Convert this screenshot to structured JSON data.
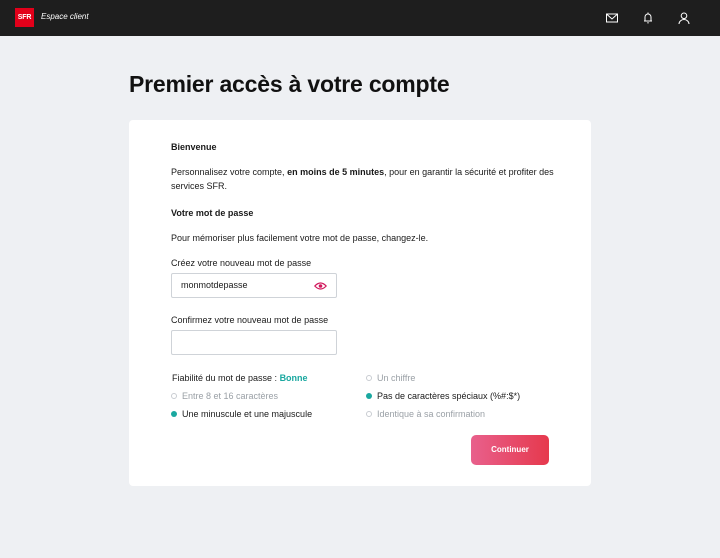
{
  "header": {
    "logo_text": "SFR",
    "brand_subtitle": "Espace client",
    "icons": [
      "mail-icon",
      "bell-icon",
      "user-icon"
    ]
  },
  "page": {
    "title": "Premier accès à votre compte"
  },
  "card": {
    "welcome_heading": "Bienvenue",
    "intro_before": "Personnalisez votre compte, ",
    "intro_bold": "en moins de 5 minutes",
    "intro_after": ", pour en garantir la sécurité et profiter des services SFR.",
    "password_heading": "Votre mot de passe",
    "password_hint": "Pour mémoriser plus facilement votre mot de passe, changez-le.",
    "new_password_label": "Créez votre nouveau mot de passe",
    "new_password_value": "monmotdepasse",
    "confirm_password_label": "Confirmez votre nouveau mot de passe",
    "confirm_password_value": "",
    "strength_label": "Fiabilité du mot de passe : ",
    "strength_value": "Bonne",
    "criteria": [
      {
        "label": "Un chiffre",
        "met": false
      },
      {
        "label": "Entre 8 et 16 caractères",
        "met": false
      },
      {
        "label": "Pas de caractères spéciaux (%#:$*)",
        "met": true
      },
      {
        "label": "Une minuscule et une majuscule",
        "met": true
      },
      {
        "label": "Identique à sa confirmation",
        "met": false
      }
    ],
    "continue_label": "Continuer"
  },
  "colors": {
    "topbar": "#1e1e1e",
    "brand_red": "#e2001a",
    "accent_teal": "#1aa8a0",
    "eye_pink": "#d1185c",
    "button_start": "#e8608c",
    "button_end": "#e6394d"
  }
}
